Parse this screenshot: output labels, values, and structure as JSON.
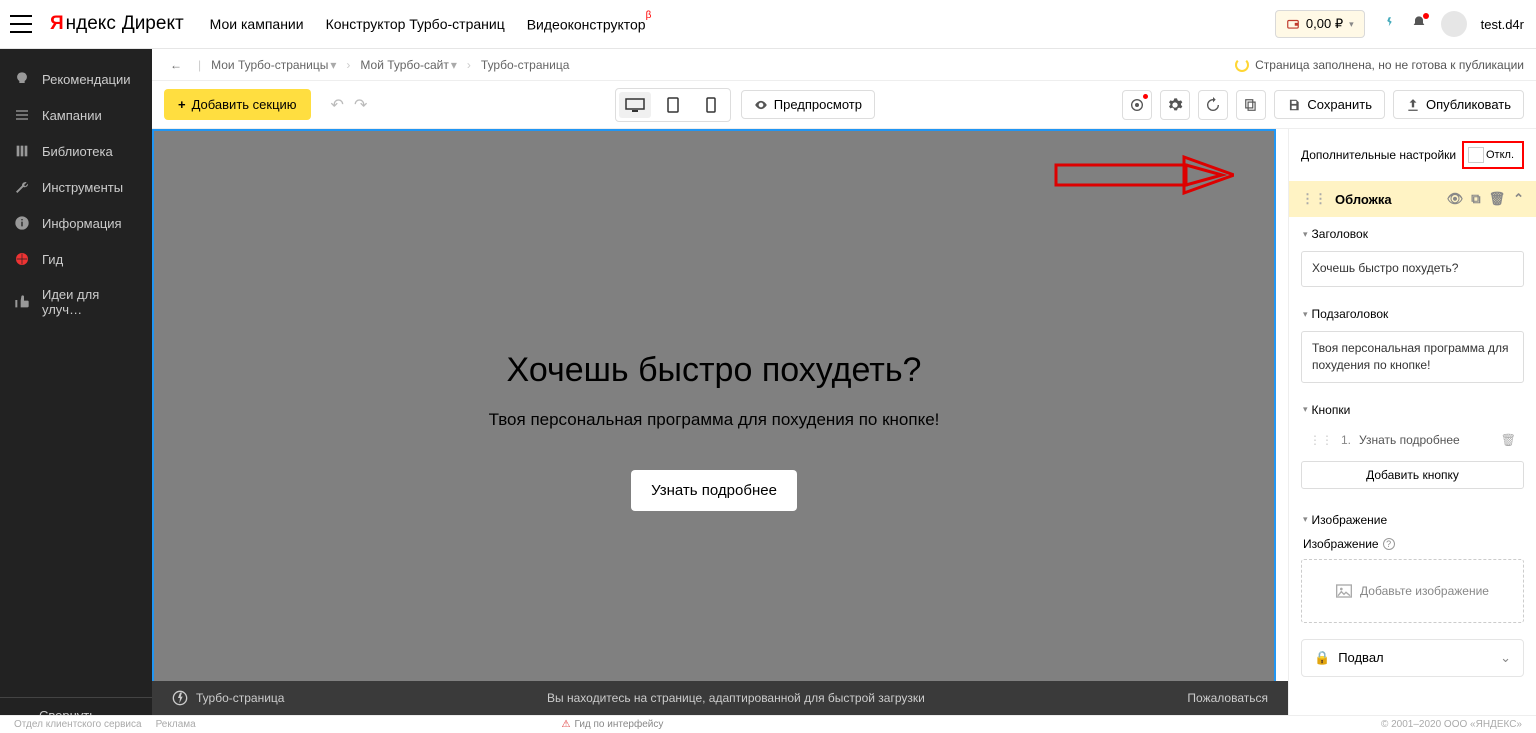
{
  "header": {
    "logo_y": "Я",
    "logo_rest": "ндекс",
    "logo_direct": "Директ",
    "nav": {
      "campaigns": "Мои кампании",
      "turbo_constructor": "Конструктор Турбо-страниц",
      "video_constructor": "Видеоконструктор",
      "video_beta": "β"
    },
    "balance": "0,00 ₽",
    "username": "test.d4r"
  },
  "sidebar": {
    "items": [
      {
        "label": "Рекомендации"
      },
      {
        "label": "Кампании"
      },
      {
        "label": "Библиотека"
      },
      {
        "label": "Инструменты"
      },
      {
        "label": "Информация"
      },
      {
        "label": "Гид"
      },
      {
        "label": "Идеи для улуч…"
      }
    ],
    "collapse": "Свернуть"
  },
  "breadcrumbs": {
    "items": [
      "Мои Турбо-страницы",
      "Мой Турбо-сайт",
      "Турбо-страница"
    ],
    "status": "Страница заполнена, но не готова к публикации"
  },
  "toolbar": {
    "add_section": "Добавить секцию",
    "preview": "Предпросмотр",
    "save": "Сохранить",
    "publish": "Опубликовать"
  },
  "canvas": {
    "title": "Хочешь быстро похудеть?",
    "subtitle": "Твоя персональная программа для похудения по кнопке!",
    "cta": "Узнать подробнее",
    "toolbar_label": "Обложка"
  },
  "rpanel": {
    "settings_label": "Дополнительные настройки",
    "toggle_off": "Откл.",
    "cover_label": "Обложка",
    "heading_label": "Заголовок",
    "heading_value": "Хочешь быстро похудеть?",
    "subheading_label": "Подзаголовок",
    "subheading_value": "Твоя персональная программа для похудения по кнопке!",
    "buttons_label": "Кнопки",
    "button1_num": "1.",
    "button1_label": "Узнать подробнее",
    "add_button": "Добавить кнопку",
    "image_section": "Изображение",
    "image_label": "Изображение",
    "image_drop": "Добавьте изображение",
    "footer_label": "Подвал"
  },
  "turbo_bar": {
    "label": "Турбо-страница",
    "center": "Вы находитесь на странице, адаптированной для быстрой загрузки",
    "complain": "Пожаловаться"
  },
  "footer": {
    "left1": "Отдел клиентского сервиса",
    "left2": "Реклама",
    "gid": "Гид по интерфейсу",
    "copyright": "© 2001–2020  ООО «ЯНДЕКС»"
  }
}
